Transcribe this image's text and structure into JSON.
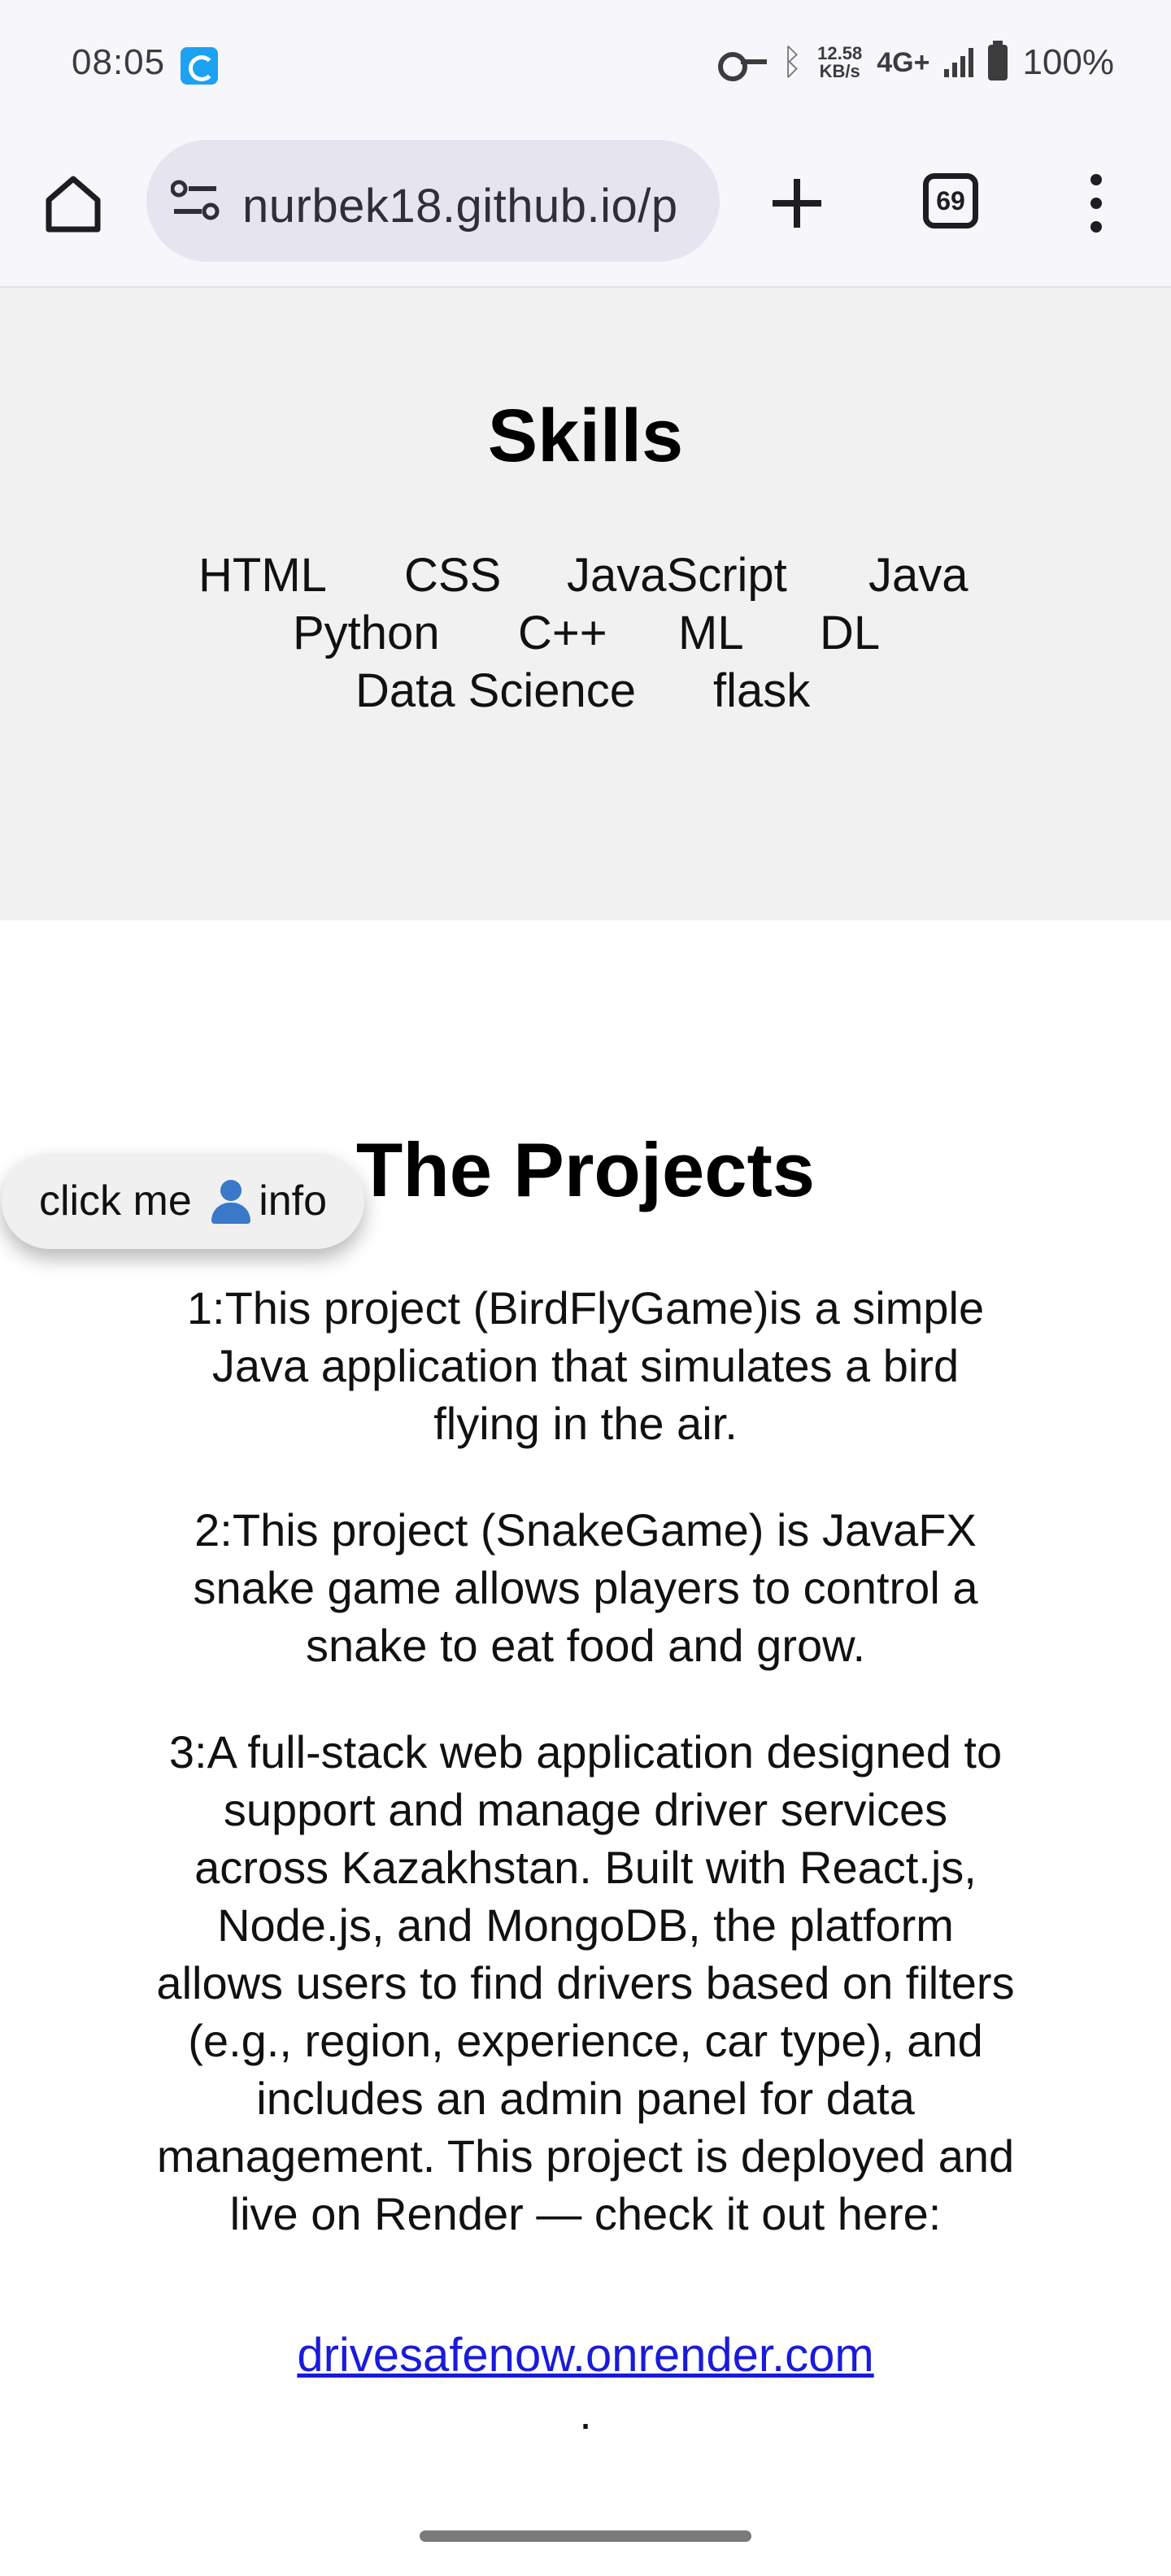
{
  "status_bar": {
    "time": "08:05",
    "net_speed_value": "12.58",
    "net_speed_unit": "KB/s",
    "network": "4G+",
    "battery": "100%"
  },
  "browser": {
    "url": "nurbek18.github.io/p",
    "tab_count": "69"
  },
  "skills": {
    "title": "Skills",
    "items": [
      "HTML",
      "CSS",
      "JavaScript",
      "Java",
      "Python",
      "C++",
      "ML",
      "DL",
      "Data Science",
      "flask"
    ]
  },
  "projects": {
    "title": "The Projects",
    "info_button_prefix": "click me ",
    "info_button_suffix": "info",
    "items": [
      "1:This project (BirdFlyGame)is a simple Java application that simulates a bird flying in the air.",
      "2:This project (SnakeGame) is JavaFX snake game allows players to control a snake to eat food and grow.",
      "3:A full-stack web application designed to support and manage driver services across Kazakhstan. Built with React.js, Node.js, and MongoDB, the platform allows users to find drivers based on filters (e.g., region, experience, car type), and includes an admin panel for data management. This project is deployed and live on Render — check it out here:"
    ],
    "link": "drivesafenow.onrender.com",
    "trailing": "."
  }
}
